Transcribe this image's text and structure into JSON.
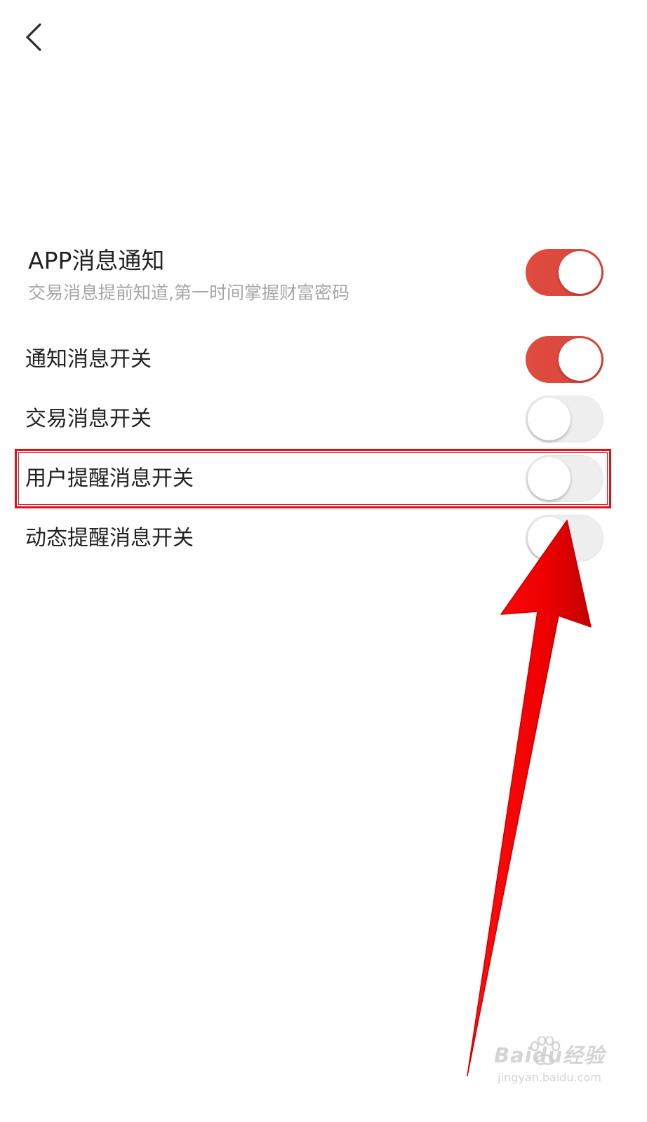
{
  "nav": {
    "back_icon": "chevron-left-icon"
  },
  "app_notification": {
    "title": "APP消息通知",
    "subtitle": "交易消息提前知道,第一时间掌握财富密码",
    "enabled": true
  },
  "switches": [
    {
      "label": "通知消息开关",
      "enabled": true
    },
    {
      "label": "交易消息开关",
      "enabled": false
    },
    {
      "label": "用户提醒消息开关",
      "enabled": false
    },
    {
      "label": "动态提醒消息开关",
      "enabled": false
    }
  ],
  "annotations": {
    "highlight_color": "#e3101a",
    "arrow_color": "#ff0000",
    "accent_color": "#dc4a40"
  },
  "watermark": {
    "brand": "Baidu经验",
    "url": "jingyan.baidu.com"
  }
}
